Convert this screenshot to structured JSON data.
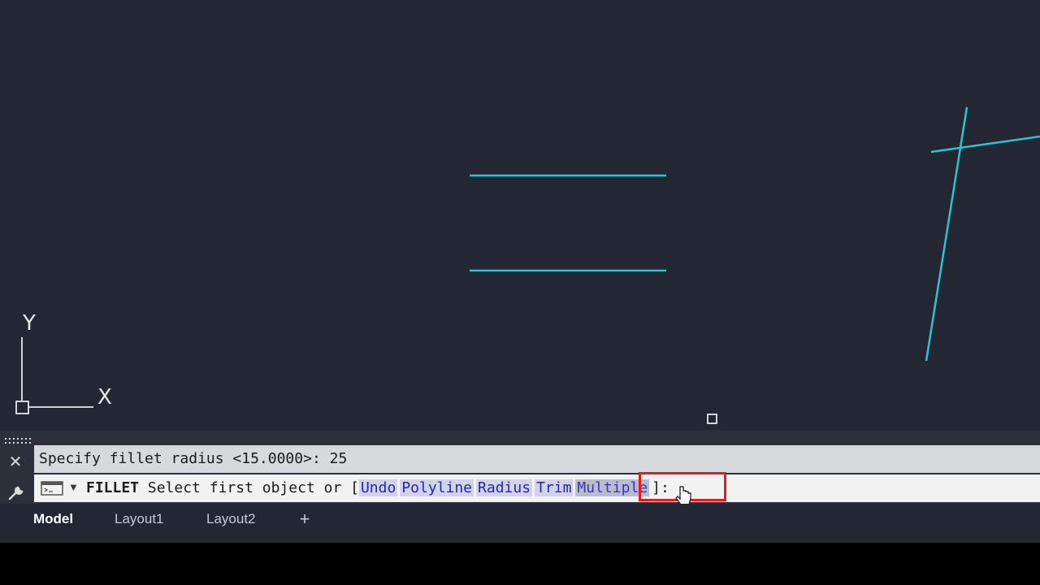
{
  "canvas": {
    "background": "#222733",
    "line_color": "#2bc4d0",
    "ucs": {
      "y_label": "Y",
      "x_label": "X"
    }
  },
  "command_window": {
    "grip_icon": "grip-dots-icon",
    "close_icon": "close-icon",
    "customize_icon": "wrench-icon",
    "history_line": "Specify fillet radius <15.0000>: 25",
    "prompt": {
      "command": "FILLET",
      "text": "Select first object or [",
      "options": [
        "Undo",
        "Polyline",
        "Radius",
        "Trim",
        "Multiple"
      ],
      "hovered_option": "Multiple",
      "suffix": "]:"
    },
    "highlight_color": "#e31b1b"
  },
  "layout_tabs": {
    "tabs": [
      "Model",
      "Layout1",
      "Layout2"
    ],
    "active": "Model",
    "add_label": "+"
  }
}
